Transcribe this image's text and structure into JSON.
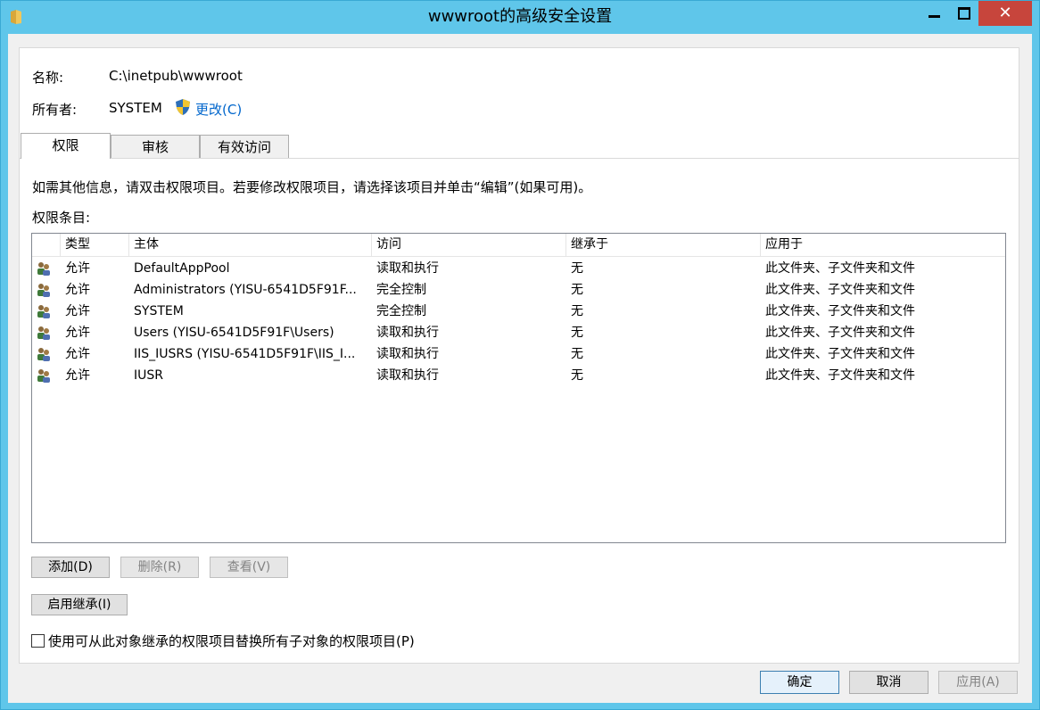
{
  "window": {
    "title": "wwwroot的高级安全设置",
    "close_glyph": "✕",
    "title_icon": "folder-icon"
  },
  "header": {
    "name_label": "名称:",
    "name_value": "C:\\inetpub\\wwwroot",
    "owner_label": "所有者:",
    "owner_value": "SYSTEM",
    "change_link": "更改(C)"
  },
  "tabs": [
    {
      "label": "权限",
      "active": true
    },
    {
      "label": "审核",
      "active": false
    },
    {
      "label": "有效访问",
      "active": false
    }
  ],
  "info_text": "如需其他信息，请双击权限项目。若要修改权限项目，请选择该项目并单击“编辑”(如果可用)。",
  "entries_label": "权限条目:",
  "columns": [
    "类型",
    "主体",
    "访问",
    "继承于",
    "应用于"
  ],
  "entries": [
    {
      "type": "允许",
      "principal": "DefaultAppPool",
      "access": "读取和执行",
      "inherited_from": "无",
      "applies_to": "此文件夹、子文件夹和文件"
    },
    {
      "type": "允许",
      "principal": "Administrators (YISU-6541D5F91F...",
      "access": "完全控制",
      "inherited_from": "无",
      "applies_to": "此文件夹、子文件夹和文件"
    },
    {
      "type": "允许",
      "principal": "SYSTEM",
      "access": "完全控制",
      "inherited_from": "无",
      "applies_to": "此文件夹、子文件夹和文件"
    },
    {
      "type": "允许",
      "principal": "Users (YISU-6541D5F91F\\Users)",
      "access": "读取和执行",
      "inherited_from": "无",
      "applies_to": "此文件夹、子文件夹和文件"
    },
    {
      "type": "允许",
      "principal": "IIS_IUSRS (YISU-6541D5F91F\\IIS_I...",
      "access": "读取和执行",
      "inherited_from": "无",
      "applies_to": "此文件夹、子文件夹和文件"
    },
    {
      "type": "允许",
      "principal": "IUSR",
      "access": "读取和执行",
      "inherited_from": "无",
      "applies_to": "此文件夹、子文件夹和文件"
    }
  ],
  "buttons": {
    "add": "添加(D)",
    "remove": "删除(R)",
    "view": "查看(V)",
    "enable_inheritance": "启用继承(I)"
  },
  "replace_checkbox": {
    "label": "使用可从此对象继承的权限项目替换所有子对象的权限项目(P)",
    "checked": false
  },
  "footer": {
    "ok": "确定",
    "cancel": "取消",
    "apply": "应用(A)"
  },
  "colors": {
    "titlebar": "#5fc6ea",
    "close_button": "#c7453c",
    "link": "#0066cc"
  }
}
